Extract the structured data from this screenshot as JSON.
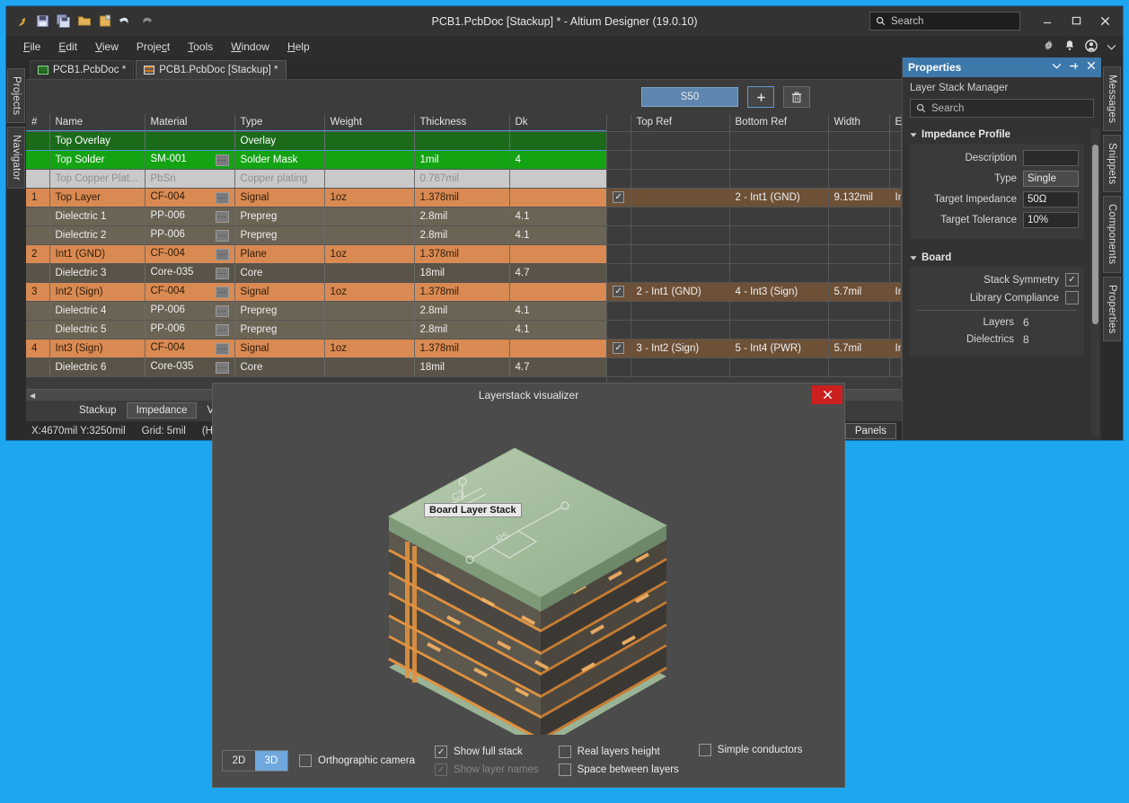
{
  "window": {
    "title": "PCB1.PcbDoc [Stackup] * - Altium Designer (19.0.10)",
    "search_placeholder": "Search",
    "minimize": "–",
    "maximize": "◻",
    "close": "✕"
  },
  "toolbar": {
    "icons": [
      "altium-logo-icon",
      "save-icon",
      "save-all-icon",
      "open-folder-icon",
      "open-project-icon",
      "undo-icon",
      "redo-icon"
    ]
  },
  "menubar": {
    "items": [
      "File",
      "Edit",
      "View",
      "Project",
      "Tools",
      "Window",
      "Help"
    ],
    "right_icons": [
      "gear-icon",
      "bell-icon",
      "account-icon",
      "chevron-down-icon"
    ]
  },
  "left_tabs": [
    "Projects",
    "Navigator"
  ],
  "right_tabs": [
    "Messages",
    "Snippets",
    "Components",
    "Properties"
  ],
  "doc_tabs": [
    {
      "label": "PCB1.PcbDoc *",
      "active": false,
      "icon": "pcb-doc-icon"
    },
    {
      "label": "PCB1.PcbDoc [Stackup] *",
      "active": true,
      "icon": "stackup-doc-icon"
    }
  ],
  "profile_bar": {
    "profile_name": "S50",
    "add_label": "+",
    "delete_label": "🗑"
  },
  "table": {
    "left_headers": [
      "#",
      "Name",
      "Material",
      "Type",
      "Weight",
      "Thickness",
      "Dk"
    ],
    "right_headers": [
      "",
      "Top Ref",
      "Bottom Ref",
      "Width",
      "Etch"
    ],
    "rows": [
      {
        "num": "",
        "name": "Top Overlay",
        "material": "",
        "type": "Overlay",
        "weight": "",
        "thickness": "",
        "dk": "",
        "style": "overlay",
        "dots": false,
        "check": "",
        "topref": "",
        "bottomref": "",
        "width": "",
        "etch": "",
        "hl": false
      },
      {
        "num": "",
        "name": "Top Solder",
        "material": "SM-001",
        "type": "Solder Mask",
        "weight": "",
        "thickness": "1mil",
        "dk": "4",
        "style": "solder",
        "dots": true,
        "check": "",
        "topref": "",
        "bottomref": "",
        "width": "",
        "etch": "",
        "hl": false
      },
      {
        "num": "",
        "name": "Top Copper Plat...",
        "material": "PbSn",
        "type": "Copper plating",
        "weight": "",
        "thickness": "0.787mil",
        "dk": "",
        "style": "plating",
        "dots": false,
        "check": "",
        "topref": "",
        "bottomref": "",
        "width": "",
        "etch": "",
        "hl": false
      },
      {
        "num": "1",
        "name": "Top Layer",
        "material": "CF-004",
        "type": "Signal",
        "weight": "1oz",
        "thickness": "1.378mil",
        "dk": "",
        "style": "signal",
        "dots": true,
        "check": "✓",
        "topref": "",
        "bottomref": "2 - Int1 (GND)",
        "width": "9.132mil",
        "etch": "Inf",
        "hl": true
      },
      {
        "num": "",
        "name": "Dielectric 1",
        "material": "PP-006",
        "type": "Prepreg",
        "weight": "",
        "thickness": "2.8mil",
        "dk": "4.1",
        "style": "diel",
        "dots": true,
        "check": "",
        "topref": "",
        "bottomref": "",
        "width": "",
        "etch": "",
        "hl": false
      },
      {
        "num": "",
        "name": "Dielectric 2",
        "material": "PP-006",
        "type": "Prepreg",
        "weight": "",
        "thickness": "2.8mil",
        "dk": "4.1",
        "style": "diel",
        "dots": true,
        "check": "",
        "topref": "",
        "bottomref": "",
        "width": "",
        "etch": "",
        "hl": false
      },
      {
        "num": "2",
        "name": "Int1 (GND)",
        "material": "CF-004",
        "type": "Plane",
        "weight": "1oz",
        "thickness": "1.378mil",
        "dk": "",
        "style": "signal",
        "dots": true,
        "check": "",
        "topref": "",
        "bottomref": "",
        "width": "",
        "etch": "",
        "hl": false
      },
      {
        "num": "",
        "name": "Dielectric 3",
        "material": "Core-035",
        "type": "Core",
        "weight": "",
        "thickness": "18mil",
        "dk": "4.7",
        "style": "core",
        "dots": true,
        "check": "",
        "topref": "",
        "bottomref": "",
        "width": "",
        "etch": "",
        "hl": false
      },
      {
        "num": "3",
        "name": "Int2 (Sign)",
        "material": "CF-004",
        "type": "Signal",
        "weight": "1oz",
        "thickness": "1.378mil",
        "dk": "",
        "style": "signal",
        "dots": true,
        "check": "✓",
        "topref": "2 - Int1 (GND)",
        "bottomref": "4 - Int3 (Sign)",
        "width": "5.7mil",
        "etch": "Inf",
        "hl": true
      },
      {
        "num": "",
        "name": "Dielectric 4",
        "material": "PP-006",
        "type": "Prepreg",
        "weight": "",
        "thickness": "2.8mil",
        "dk": "4.1",
        "style": "diel",
        "dots": true,
        "check": "",
        "topref": "",
        "bottomref": "",
        "width": "",
        "etch": "",
        "hl": false
      },
      {
        "num": "",
        "name": "Dielectric 5",
        "material": "PP-006",
        "type": "Prepreg",
        "weight": "",
        "thickness": "2.8mil",
        "dk": "4.1",
        "style": "diel",
        "dots": true,
        "check": "",
        "topref": "",
        "bottomref": "",
        "width": "",
        "etch": "",
        "hl": false
      },
      {
        "num": "4",
        "name": "Int3 (Sign)",
        "material": "CF-004",
        "type": "Signal",
        "weight": "1oz",
        "thickness": "1.378mil",
        "dk": "",
        "style": "signal",
        "dots": true,
        "check": "✓",
        "topref": "3 - Int2 (Sign)",
        "bottomref": "5 - Int4 (PWR)",
        "width": "5.7mil",
        "etch": "Inf",
        "hl": true
      },
      {
        "num": "",
        "name": "Dielectric 6",
        "material": "Core-035",
        "type": "Core",
        "weight": "",
        "thickness": "18mil",
        "dk": "4.7",
        "style": "core",
        "dots": true,
        "check": "",
        "topref": "",
        "bottomref": "",
        "width": "",
        "etch": "",
        "hl": false
      }
    ]
  },
  "bottom_tabs": [
    {
      "label": "Stackup",
      "active": false
    },
    {
      "label": "Impedance",
      "active": true
    },
    {
      "label": "Via Types",
      "active": false
    }
  ],
  "status": {
    "coords": "X:4670mil Y:3250mil",
    "grid": "Grid: 5mil",
    "hotspot": "(Hotspot",
    "panels": "Panels"
  },
  "properties": {
    "title": "Properties",
    "actions": [
      "chevron-down-icon",
      "pin-icon",
      "close-icon"
    ],
    "subtitle": "Layer Stack Manager",
    "search_placeholder": "Search",
    "sections": [
      {
        "title": "Impedance Profile",
        "fields": [
          {
            "label": "Description",
            "value": "",
            "raised": false
          },
          {
            "label": "Type",
            "value": "Single",
            "raised": true
          },
          {
            "label": "Target Impedance",
            "value": "50Ω",
            "raised": false
          },
          {
            "label": "Target Tolerance",
            "value": "10%",
            "raised": false
          }
        ]
      },
      {
        "title": "Board",
        "checks": [
          {
            "label": "Stack Symmetry",
            "checked": true
          },
          {
            "label": "Library Compliance",
            "checked": false
          }
        ],
        "counts": [
          {
            "label": "Layers",
            "value": "6"
          },
          {
            "label": "Dielectrics",
            "value": "8"
          }
        ]
      }
    ]
  },
  "dialog": {
    "title": "Layerstack visualizer",
    "close_label": "✕",
    "viewport_label": "Board Layer Stack",
    "view_modes": [
      {
        "label": "2D",
        "active": false
      },
      {
        "label": "3D",
        "active": true
      }
    ],
    "options": [
      {
        "label": "Orthographic camera",
        "checked": false,
        "disabled": false
      },
      {
        "label": "Show full stack",
        "checked": true,
        "disabled": false
      },
      {
        "label": "Show layer names",
        "checked": true,
        "disabled": true
      },
      {
        "label": "Real layers height",
        "checked": false,
        "disabled": false
      },
      {
        "label": "Space between layers",
        "checked": false,
        "disabled": false
      },
      {
        "label": "Simple conductors",
        "checked": false,
        "disabled": false
      }
    ],
    "silkscreen": [
      "C3",
      "R5"
    ]
  },
  "colors": {
    "desktop": "#1ea7f0",
    "accent": "#3d78ab",
    "signal_row": "#d98a52",
    "solder_row": "#13a313",
    "overlay_row": "#1b6b1b",
    "close_red": "#cc1f1f"
  }
}
